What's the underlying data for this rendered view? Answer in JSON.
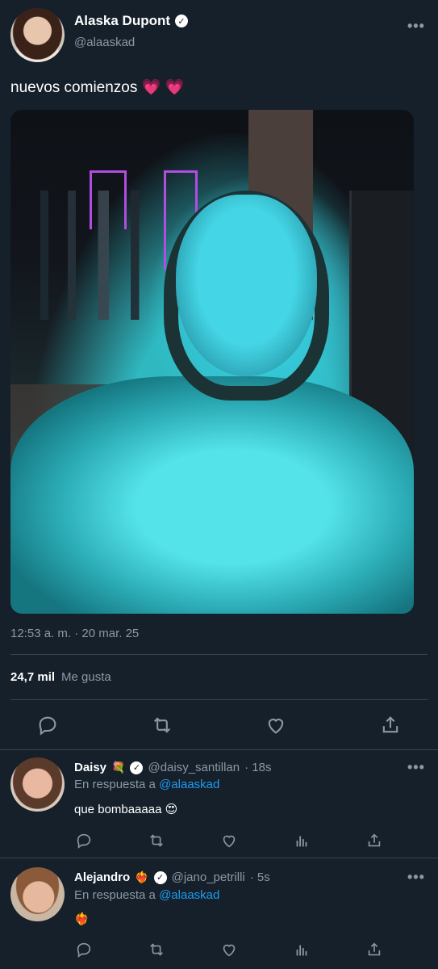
{
  "tweet": {
    "author_name": "Alaska Dupont",
    "author_handle": "@alaaskad",
    "more_icon": "•••",
    "text": "nuevos comienzos",
    "emojis": "💗 💗",
    "timestamp": "12:53 a. m. · 20 mar. 25",
    "likes_count": "24,7 mil",
    "likes_label": "Me gusta"
  },
  "actions": [
    "reply-icon",
    "retweet-icon",
    "like-icon",
    "share-icon"
  ],
  "replies": [
    {
      "name": "Daisy",
      "emoji": "💐",
      "handle": "@daisy_santillan",
      "time": "· 18s",
      "reply_prefix": "En respuesta a",
      "reply_to": "@alaaskad",
      "text": "que bombaaaaa 😍",
      "more_icon": "•••"
    },
    {
      "name": "Alejandro",
      "emoji": "❤️‍🔥",
      "handle": "@jano_petrilli",
      "time": "· 5s",
      "reply_prefix": "En respuesta a",
      "reply_to": "@alaaskad",
      "text": "❤️‍🔥",
      "more_icon": "•••"
    }
  ],
  "colors": {
    "background": "#15202b",
    "muted": "#8b98a5",
    "link": "#1d9bf0",
    "divider": "#38444d"
  }
}
